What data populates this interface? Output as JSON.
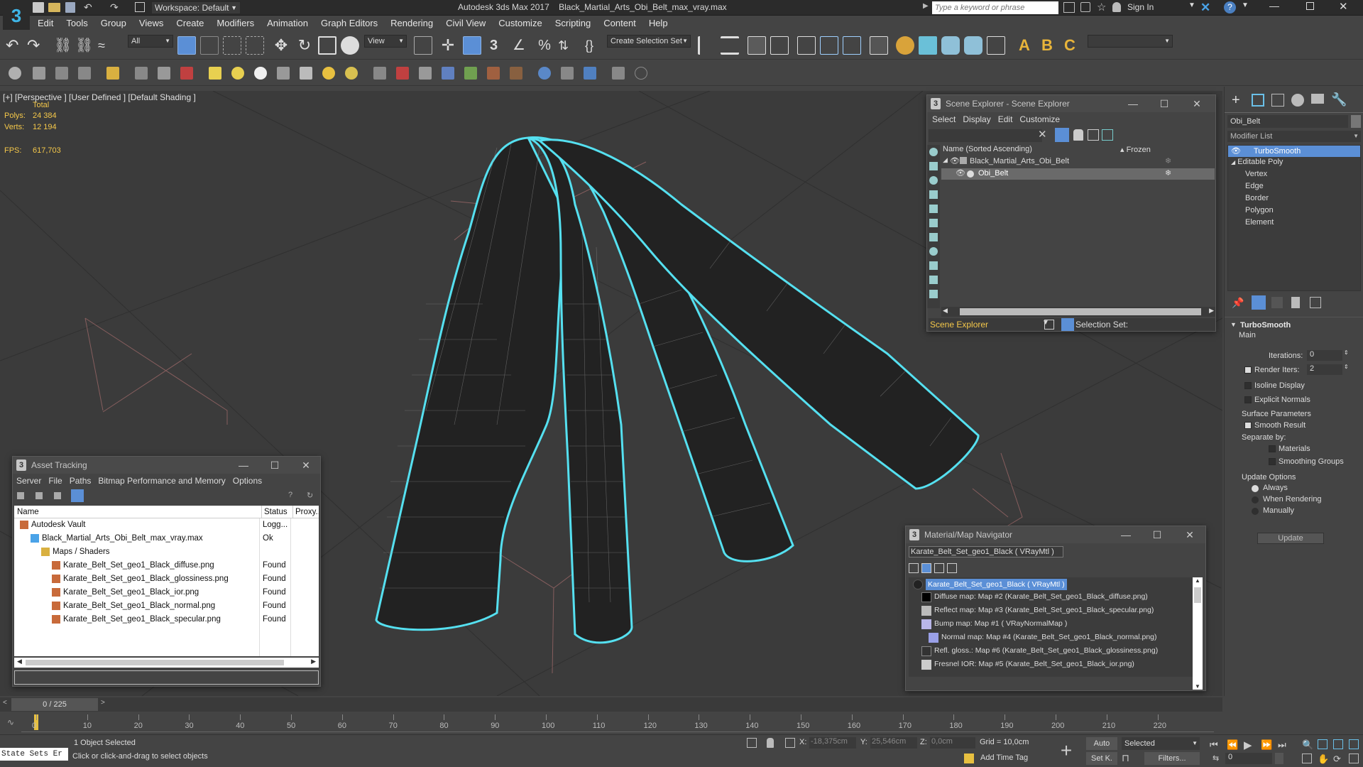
{
  "title_bar": {
    "workspace_label": "Workspace: Default",
    "app_title": "Autodesk 3ds Max 2017",
    "file_title": "Black_Martial_Arts_Obi_Belt_max_vray.max",
    "search_placeholder": "Type a keyword or phrase",
    "sign_in": "Sign In"
  },
  "menu": [
    "Edit",
    "Tools",
    "Group",
    "Views",
    "Create",
    "Modifiers",
    "Animation",
    "Graph Editors",
    "Rendering",
    "Civil View",
    "Customize",
    "Scripting",
    "Content",
    "Help"
  ],
  "toolbar": {
    "filter_value": "All",
    "view_value": "View",
    "selection_set_value": "Create Selection Set"
  },
  "viewport": {
    "label": "[+] [Perspective ] [User Defined ] [Default Shading ]",
    "stats_total_label": "Total",
    "polys_label": "Polys:",
    "polys_value": "24 384",
    "verts_label": "Verts:",
    "verts_value": "12 194",
    "fps_label": "FPS:",
    "fps_value": "617,703"
  },
  "scene_explorer": {
    "title": "Scene Explorer - Scene Explorer",
    "menu": [
      "Select",
      "Display",
      "Edit",
      "Customize"
    ],
    "col_name": "Name (Sorted Ascending)",
    "col_frozen": "▴ Frozen",
    "rows": [
      "Black_Martial_Arts_Obi_Belt",
      "Obi_Belt"
    ],
    "footer_label": "Scene Explorer",
    "selection_set_label": "Selection Set:"
  },
  "command_panel": {
    "object_name": "Obi_Belt",
    "modifier_list": "Modifier List",
    "stack": [
      "TurboSmooth",
      "Editable Poly",
      "Vertex",
      "Edge",
      "Border",
      "Polygon",
      "Element"
    ],
    "turbosmooth": {
      "header": "TurboSmooth",
      "main": "Main",
      "iterations_label": "Iterations:",
      "iterations_value": "0",
      "render_iters_label": "Render Iters:",
      "render_iters_value": "2",
      "isoline": "Isoline Display",
      "explicit_normals": "Explicit Normals",
      "surface_params": "Surface Parameters",
      "smooth_result": "Smooth Result",
      "separate_by": "Separate by:",
      "materials": "Materials",
      "smoothing_groups": "Smoothing Groups",
      "update_options": "Update Options",
      "always": "Always",
      "when_rendering": "When Rendering",
      "manually": "Manually",
      "update_button": "Update"
    }
  },
  "asset_tracking": {
    "title": "Asset Tracking",
    "menu": [
      "Server",
      "File",
      "Paths",
      "Bitmap Performance and Memory",
      "Options"
    ],
    "columns": [
      "Name",
      "Status",
      "Proxy..."
    ],
    "rows": [
      {
        "name": "Autodesk Vault",
        "status": "Logg...",
        "indent": 0
      },
      {
        "name": "Black_Martial_Arts_Obi_Belt_max_vray.max",
        "status": "Ok",
        "indent": 1
      },
      {
        "name": "Maps / Shaders",
        "status": "",
        "indent": 2
      },
      {
        "name": "Karate_Belt_Set_geo1_Black_diffuse.png",
        "status": "Found",
        "indent": 3
      },
      {
        "name": "Karate_Belt_Set_geo1_Black_glossiness.png",
        "status": "Found",
        "indent": 3
      },
      {
        "name": "Karate_Belt_Set_geo1_Black_ior.png",
        "status": "Found",
        "indent": 3
      },
      {
        "name": "Karate_Belt_Set_geo1_Black_normal.png",
        "status": "Found",
        "indent": 3
      },
      {
        "name": "Karate_Belt_Set_geo1_Black_specular.png",
        "status": "Found",
        "indent": 3
      }
    ]
  },
  "material_navigator": {
    "title": "Material/Map Navigator",
    "current": "Karate_Belt_Set_geo1_Black  ( VRayMtl )",
    "items": [
      "Karate_Belt_Set_geo1_Black  ( VRayMtl )",
      "Diffuse map: Map #2 (Karate_Belt_Set_geo1_Black_diffuse.png)",
      "Reflect map: Map #3 (Karate_Belt_Set_geo1_Black_specular.png)",
      "Bump map: Map #1  ( VRayNormalMap )",
      "Normal map: Map #4 (Karate_Belt_Set_geo1_Black_normal.png)",
      "Refl. gloss.: Map #6 (Karate_Belt_Set_geo1_Black_glossiness.png)",
      "Fresnel IOR: Map #5 (Karate_Belt_Set_geo1_Black_ior.png)"
    ]
  },
  "timeline": {
    "frame_counter": "0 / 225",
    "ticks": [
      "0",
      "10",
      "20",
      "30",
      "40",
      "50",
      "60",
      "70",
      "80",
      "90",
      "100",
      "110",
      "120",
      "130",
      "140",
      "150",
      "160",
      "170",
      "180",
      "190",
      "200",
      "210",
      "220"
    ]
  },
  "status": {
    "script_label": "State Sets Er",
    "objects_selected": "1 Object Selected",
    "prompt": "Click or click-and-drag to select objects",
    "x_label": "X:",
    "x_value": "-18,375cm",
    "y_label": "Y:",
    "y_value": "25,546cm",
    "z_label": "Z:",
    "z_value": "0,0cm",
    "grid": "Grid = 10,0cm",
    "add_time_tag": "Add Time Tag",
    "auto": "Auto",
    "set_k": "Set K.",
    "selected": "Selected",
    "filters": "Filters...",
    "frame_value": "0"
  },
  "colors": {
    "selection_cyan": "#55e0f0",
    "highlight_blue": "#5b8fd6",
    "stat_yellow": "#f5c84a"
  }
}
